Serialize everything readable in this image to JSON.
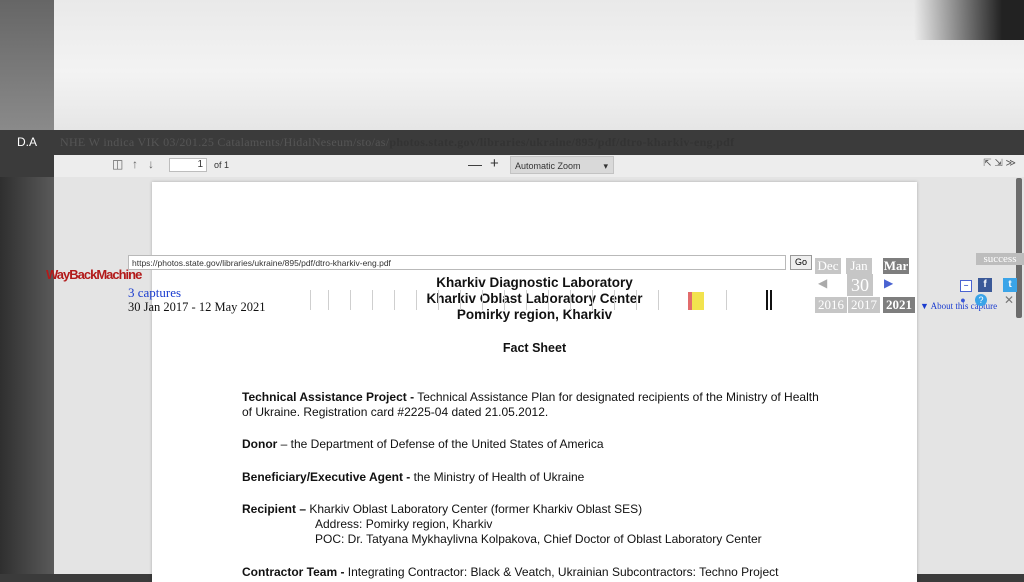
{
  "browser": {
    "url_display": "photos.state.gov/libraries/ukraine/895/pdf/dtro-kharkiv-eng.pdf",
    "url_prefix_garbled": "NHE W indica VIK 03/201.25 Catalaments/HidalNeseum/sto/as/",
    "url_suffix_garbled": "/libraries/ukraine/895/pdf/dtro-kharkiv-eng.pdf",
    "left_tag": "D.A"
  },
  "pdf_toolbar": {
    "page_number": "1",
    "page_of": "of 1",
    "zoom_out": "—",
    "zoom_in": "+",
    "zoom_label": "Automatic Zoom",
    "right_tools": "⇱ ⇲ ≫"
  },
  "document": {
    "title_line1": "Kharkiv Diagnostic Laboratory",
    "title_line2": "Kharkiv Oblast Laboratory Center",
    "title_line3": "Pomirky region, Kharkiv",
    "heading": "Fact Sheet",
    "tap_label": "Technical Assistance Project -",
    "tap_text": " Technical Assistance Plan for designated recipients of the Ministry of Health of Ukraine. Registration card #2225-04 dated 21.05.2012.",
    "donor_label": "Donor",
    "donor_text": " – the Department of Defense of the United States of America",
    "beneficiary_label": "Beneficiary/Executive Agent -",
    "beneficiary_text": " the Ministry of Health of Ukraine",
    "recipient_label": "Recipient –",
    "recipient_text": " Kharkiv Oblast Laboratory Center (former Kharkiv Oblast SES)",
    "recipient_address": "Address: Pomirky region, Kharkiv",
    "recipient_poc": "POC: Dr. Tatyana Mykhaylivna Kolpakova, Chief Doctor of Oblast Laboratory Center",
    "contractor_label": "Contractor Team -",
    "contractor_text": " Integrating Contractor: Black & Veatch, Ukrainian Subcontractors: Techno Project"
  },
  "wayback": {
    "logo_text": "WayBackMachine",
    "url_value": "https://photos.state.gov/libraries/ukraine/895/pdf/dtro-kharkiv-eng.pdf",
    "go_label": "Go",
    "captures_label": "3 captures",
    "date_range": "30 Jan 2017 - 12 May 2021",
    "month_prev": "Dec",
    "month_cur": "Jan",
    "month_next": "Mar",
    "day": "30",
    "year_prev": "2016",
    "year_cur": "2017",
    "year_next": "2021",
    "about_link": "▼ About this capture",
    "success_label": "success",
    "fb_label": "f",
    "tw_label": "t"
  }
}
